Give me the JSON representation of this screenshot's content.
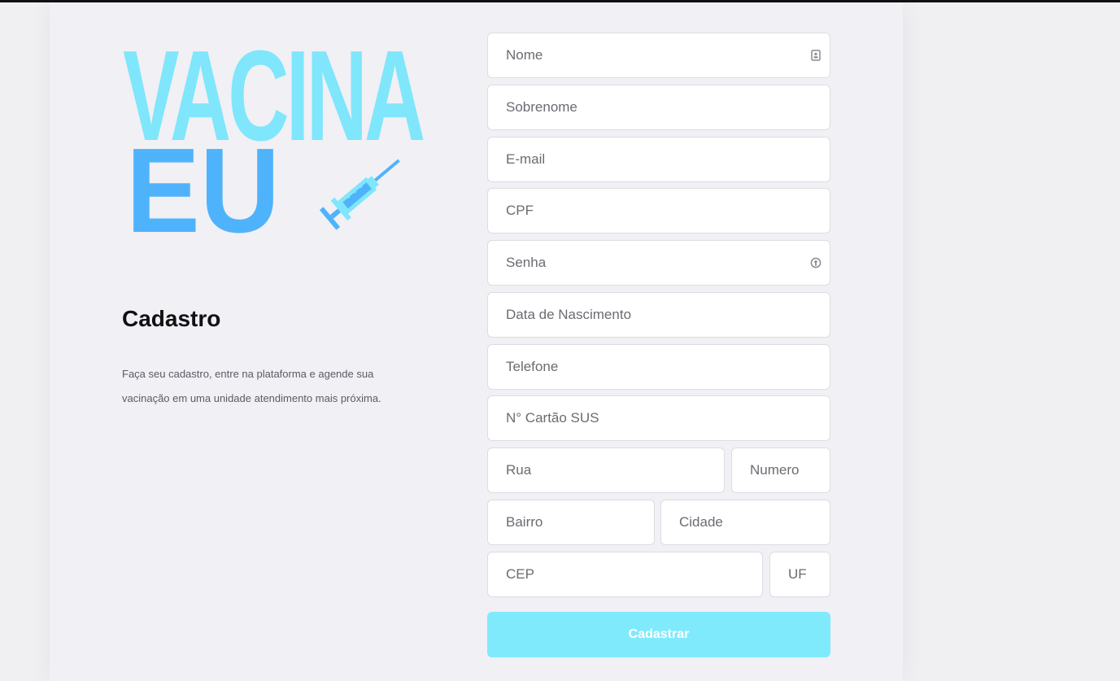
{
  "logo": {
    "line1": "VACINA",
    "line2": "EU",
    "colors": {
      "line1": "#7fe6fb",
      "line2": "#4fb3fb"
    },
    "icon": "syringe-icon"
  },
  "intro": {
    "heading": "Cadastro",
    "description": "Faça seu cadastro, entre na plataforma e agende sua vacinação em uma unidade atendimento mais próxima."
  },
  "form": {
    "fields": {
      "nome": {
        "placeholder": "Nome",
        "value": "",
        "icon": "contact-card-icon"
      },
      "sobrenome": {
        "placeholder": "Sobrenome",
        "value": ""
      },
      "email": {
        "placeholder": "E-mail",
        "value": ""
      },
      "cpf": {
        "placeholder": "CPF",
        "value": ""
      },
      "senha": {
        "placeholder": "Senha",
        "value": "",
        "icon": "password-key-icon"
      },
      "nascimento": {
        "placeholder": "Data de Nascimento",
        "value": ""
      },
      "telefone": {
        "placeholder": "Telefone",
        "value": ""
      },
      "cartao_sus": {
        "placeholder": "N° Cartão SUS",
        "value": ""
      },
      "rua": {
        "placeholder": "Rua",
        "value": ""
      },
      "numero": {
        "placeholder": "Numero",
        "value": ""
      },
      "bairro": {
        "placeholder": "Bairro",
        "value": ""
      },
      "cidade": {
        "placeholder": "Cidade",
        "value": ""
      },
      "cep": {
        "placeholder": "CEP",
        "value": ""
      },
      "uf": {
        "placeholder": "UF",
        "value": ""
      }
    },
    "submit_label": "Cadastrar",
    "accent_color": "#80eafd"
  }
}
